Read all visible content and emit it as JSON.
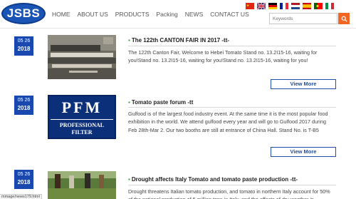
{
  "logo": {
    "text": "JSBS"
  },
  "nav": [
    "HOME",
    "ABOUT US",
    "PRODUCTS",
    "Packing",
    "NEWS",
    "CONTACT US"
  ],
  "search": {
    "placeholder": "Keywords"
  },
  "languages": [
    "chinese",
    "english",
    "german",
    "french",
    "dutch",
    "spanish",
    "portuguese",
    "italian"
  ],
  "news": [
    {
      "month_day": "05 26",
      "year": "2018",
      "title": "The 122th CANTON FAIR IN 2017 -tt-",
      "description": "The 122th Canton Fair, Welcome to Hebei Tomato Stand no. 13.2I15-16, waiting for you!Stand no. 13.2I15-16, waiting for you!Stand no. 13.2I15-16, waiting for you!",
      "more": "View More"
    },
    {
      "month_day": "05 26",
      "year": "2018",
      "title": "Tomato paste forum -tt",
      "description": "Gulfood is of the largest food industry event. At the same time it is the most popular food exhibition in the world. We attend gulfood every year and will go to Gulfood 2017 during Feb 28th-Mar 2. Our two booths are still at entrance of China Hall. Stand No. is T-B5",
      "more": "View More",
      "thumb_text": [
        "PFM",
        "PROFESSIONAL",
        "FILTER"
      ]
    },
    {
      "month_day": "05 26",
      "year": "2018",
      "title": "Drought affects Italy Tomato and tomato paste production -tt-",
      "description": "Drought threatens Italian tomato production, and tomato in northern Italy account for 50% of the national production of 5 million tons in Italy, and the effects of dry weather in"
    }
  ],
  "status_bar": "mmage/news179.html"
}
